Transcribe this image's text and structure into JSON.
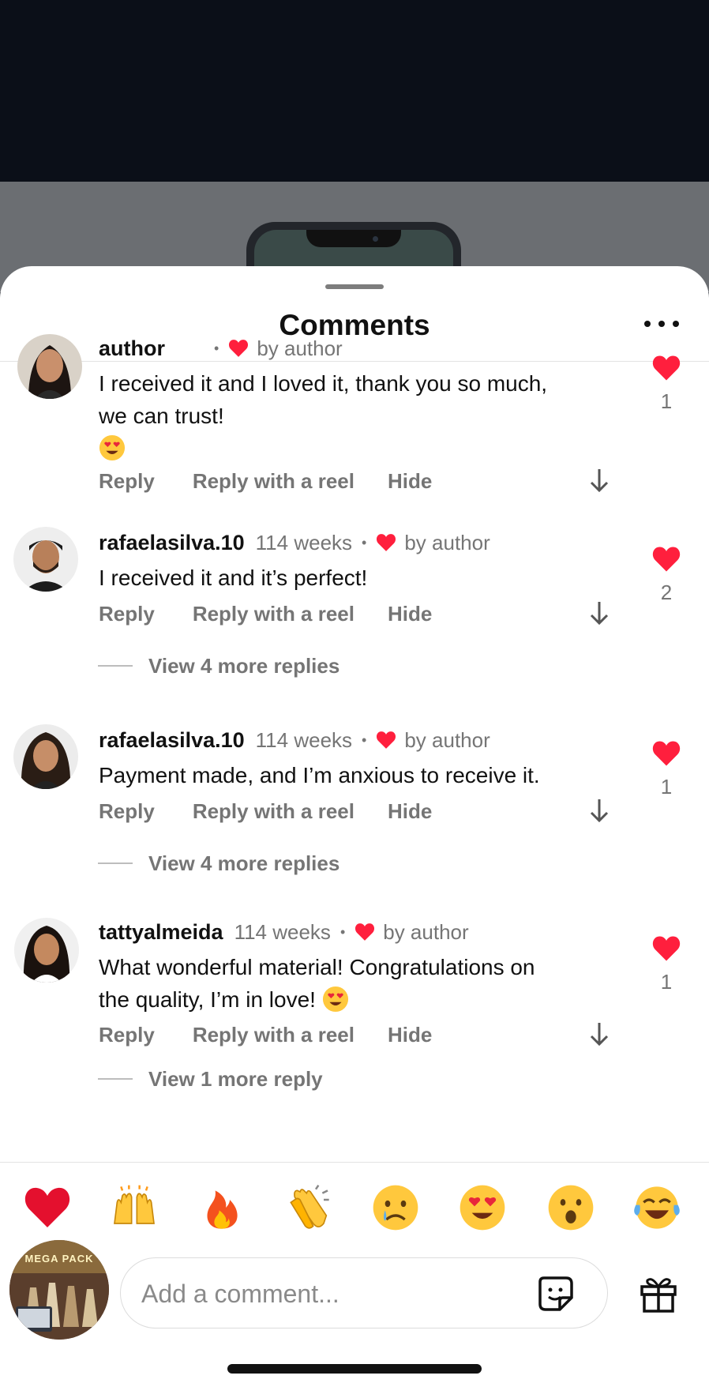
{
  "sheet": {
    "title": "Comments"
  },
  "comments": [
    {
      "username": "author",
      "time": "",
      "liked_by": "by author",
      "text": "I received it and I loved it, thank you so much, we can trust!",
      "emoji": "smiling-face-with-heart-eyes",
      "actions": {
        "reply": "Reply",
        "reply_reel": "Reply with a reel",
        "hide": "Hide"
      },
      "likes": "1"
    },
    {
      "username": "rafaelasilva.10",
      "time": "114 weeks",
      "liked_by": "by author",
      "text": "I received it and it’s perfect!",
      "actions": {
        "reply": "Reply",
        "reply_reel": "Reply with a reel",
        "hide": "Hide"
      },
      "likes": "2",
      "view_replies": "View 4 more replies"
    },
    {
      "username": "rafaelasilva.10",
      "time": "114 weeks",
      "liked_by": "by author",
      "text": "Payment made, and I’m anxious to receive it.",
      "actions": {
        "reply": "Reply",
        "reply_reel": "Reply with a reel",
        "hide": "Hide"
      },
      "likes": "1",
      "view_replies": "View 4 more replies"
    },
    {
      "username": "tattyalmeida",
      "time": "114 weeks",
      "liked_by": "by author",
      "text": "What wonderful material! Congratulations on the quality, I’m in love!",
      "emoji": "smiling-face-with-heart-eyes",
      "actions": {
        "reply": "Reply",
        "reply_reel": "Reply with a reel",
        "hide": "Hide"
      },
      "likes": "1",
      "view_replies": "View 1 more reply"
    }
  ],
  "quick_reactions": [
    "red-heart",
    "raising-hands",
    "fire",
    "clapping-hands",
    "crying-face",
    "heart-eyes",
    "surprised-face",
    "tears-of-joy"
  ],
  "post_thumbnail": {
    "text": "MEGA PACK"
  },
  "composer": {
    "placeholder": "Add a comment..."
  },
  "colors": {
    "heart": "#ff1f3d",
    "muted_text": "#757575",
    "background": "#ffffff",
    "backdrop": "#0b0f18"
  }
}
